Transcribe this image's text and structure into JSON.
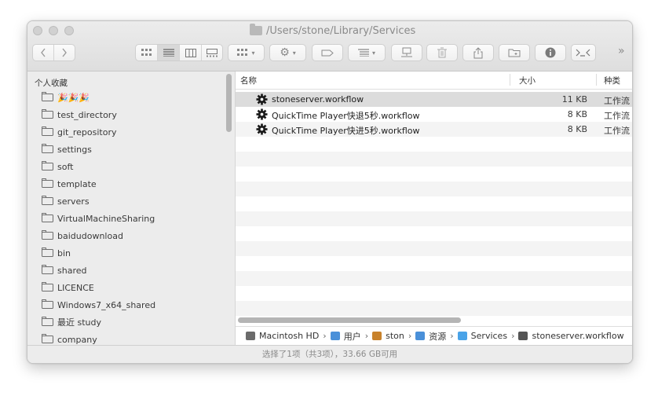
{
  "window": {
    "title": "/Users/stone/Library/Services"
  },
  "toolbar": {
    "view_buttons": [
      "icon-view",
      "list-view",
      "column-view",
      "gallery-view"
    ],
    "more_label": "»"
  },
  "sidebar": {
    "header": "个人收藏",
    "items": [
      {
        "label": "🎉🎉🎉"
      },
      {
        "label": "test_directory"
      },
      {
        "label": "git_repository"
      },
      {
        "label": "settings"
      },
      {
        "label": "soft"
      },
      {
        "label": "template"
      },
      {
        "label": "servers"
      },
      {
        "label": "VirtualMachineSharing"
      },
      {
        "label": "baidudownload"
      },
      {
        "label": "bin"
      },
      {
        "label": "shared"
      },
      {
        "label": "LICENCE"
      },
      {
        "label": "Windows7_x64_shared"
      },
      {
        "label": "最近 study"
      },
      {
        "label": "company"
      }
    ]
  },
  "filelist": {
    "columns": {
      "name": "名称",
      "size": "大小",
      "kind": "种类"
    },
    "rows": [
      {
        "name": "stoneserver.workflow",
        "size": "11 KB",
        "kind": "工作流"
      },
      {
        "name": "QuickTime Player快退5秒.workflow",
        "size": "8 KB",
        "kind": "工作流"
      },
      {
        "name": "QuickTime Player快进5秒.workflow",
        "size": "8 KB",
        "kind": "工作流"
      }
    ]
  },
  "pathbar": {
    "items": [
      {
        "label": "Macintosh HD",
        "icon": "disk-icon",
        "color": "#6b6b6b"
      },
      {
        "label": "用户",
        "icon": "users-folder-icon",
        "color": "#4a90d9"
      },
      {
        "label": "ston",
        "icon": "home-icon",
        "color": "#c8822c"
      },
      {
        "label": "资源",
        "icon": "library-folder-icon",
        "color": "#4a90d9"
      },
      {
        "label": "Services",
        "icon": "folder-icon",
        "color": "#4aa3e8"
      },
      {
        "label": "stoneserver.workflow",
        "icon": "workflow-file-icon",
        "color": "#555555"
      }
    ]
  },
  "status": {
    "text": "选择了1项（共3项），33.66 GB可用"
  }
}
